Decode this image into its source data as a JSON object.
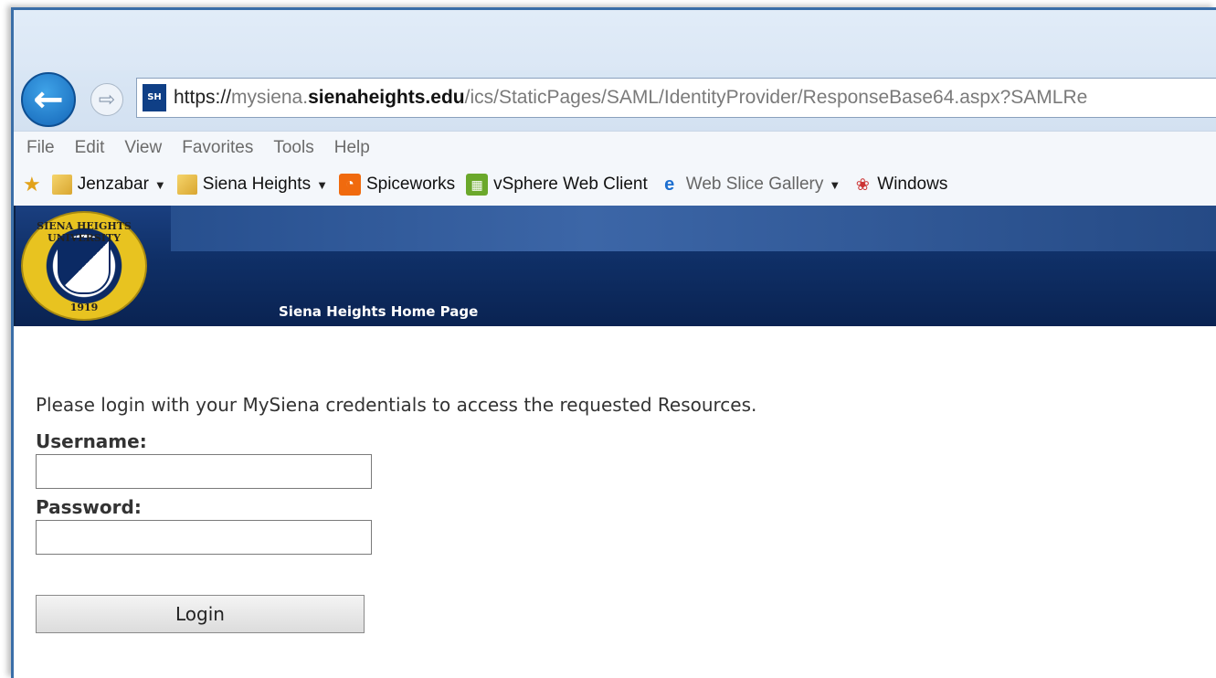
{
  "browser": {
    "url_scheme": "https://",
    "url_host_prefix": "mysiena.",
    "url_host_domain": "sienaheights.edu",
    "url_path": "/ics/StaticPages/SAML/IdentityProvider/ResponseBase64.aspx?SAMLRe",
    "site_icon_text": "SH"
  },
  "menu": [
    "File",
    "Edit",
    "View",
    "Favorites",
    "Tools",
    "Help"
  ],
  "favorites": [
    {
      "label": "Jenzabar",
      "icon": "folder-icon",
      "dropdown": true
    },
    {
      "label": "Siena Heights",
      "icon": "folder-icon",
      "dropdown": true
    },
    {
      "label": "Spiceworks",
      "icon": "spiceworks-icon",
      "dropdown": false
    },
    {
      "label": "vSphere Web Client",
      "icon": "vsphere-icon",
      "dropdown": false
    },
    {
      "label": "Web Slice Gallery",
      "icon": "ie-icon",
      "dropdown": true
    },
    {
      "label": "Windows",
      "icon": "windows-icon",
      "dropdown": false
    }
  ],
  "site": {
    "seal_top": "SIENA HEIGHTS UNIVERSITY",
    "seal_year": "1919",
    "home_title": "Siena Heights Home Page"
  },
  "login": {
    "intro": "Please login with your MySiena credentials to access the requested Resources.",
    "username_label": "Username:",
    "password_label": "Password:",
    "username_value": "",
    "password_value": "",
    "button_label": "Login"
  }
}
